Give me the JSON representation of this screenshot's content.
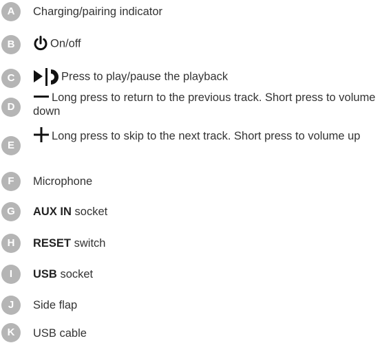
{
  "badge_color": "#b5b5b5",
  "text_color": "#333333",
  "items": [
    {
      "letter": "A",
      "text": "Charging/pairing indicator"
    },
    {
      "letter": "B",
      "icon": "power-icon",
      "text": "On/off"
    },
    {
      "letter": "C",
      "icon": "play-pause-icon",
      "text": "Press to play/pause the playback"
    },
    {
      "letter": "D",
      "icon": "minus-icon",
      "text": "Long press to return to the previous track. Short press to volume down"
    },
    {
      "letter": "E",
      "icon": "plus-icon",
      "text": "Long press to skip to the next track. Short press to volume up"
    },
    {
      "letter": "F",
      "text": "Microphone"
    },
    {
      "letter": "G",
      "bold": "AUX IN",
      "text": "socket"
    },
    {
      "letter": "H",
      "bold": "RESET",
      "text": "switch"
    },
    {
      "letter": "I",
      "bold": "USB",
      "text": "socket"
    },
    {
      "letter": "J",
      "text": "Side flap"
    },
    {
      "letter": "K",
      "text": "USB cable"
    }
  ]
}
